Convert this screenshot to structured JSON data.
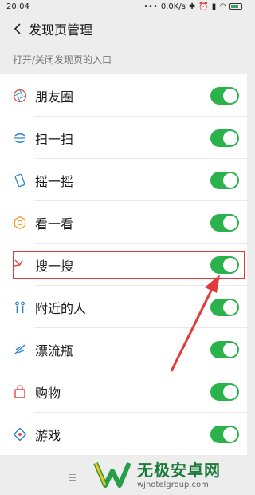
{
  "status_bar": {
    "time": "20:04",
    "net_speed": "0.0K/s"
  },
  "header": {
    "title": "发现页管理"
  },
  "section": {
    "label": "打开/关闭发现页的入口"
  },
  "items": [
    {
      "label": "朋友圈",
      "icon": "moments-icon",
      "enabled": true,
      "color": "#e85c3a"
    },
    {
      "label": "扫一扫",
      "icon": "scan-icon",
      "enabled": true,
      "color": "#2a7fd1"
    },
    {
      "label": "摇一摇",
      "icon": "shake-icon",
      "enabled": true,
      "color": "#2a7fd1"
    },
    {
      "label": "看一看",
      "icon": "top-stories-icon",
      "enabled": true,
      "color": "#f2a13a"
    },
    {
      "label": "搜一搜",
      "icon": "search-icon",
      "enabled": true,
      "color": "#e84545"
    },
    {
      "label": "附近的人",
      "icon": "people-nearby-icon",
      "enabled": true,
      "color": "#2a7fd1"
    },
    {
      "label": "漂流瓶",
      "icon": "drift-bottle-icon",
      "enabled": true,
      "color": "#2a7fd1"
    },
    {
      "label": "购物",
      "icon": "shopping-icon",
      "enabled": true,
      "color": "#e84545"
    },
    {
      "label": "游戏",
      "icon": "games-icon",
      "enabled": true,
      "color": "#2a7fd1"
    }
  ],
  "colors": {
    "toggle_on": "#2bb24c",
    "highlight": "#e03a3a"
  },
  "watermark": {
    "title": "无极安卓网",
    "url": "wjhotelgroup.com"
  }
}
